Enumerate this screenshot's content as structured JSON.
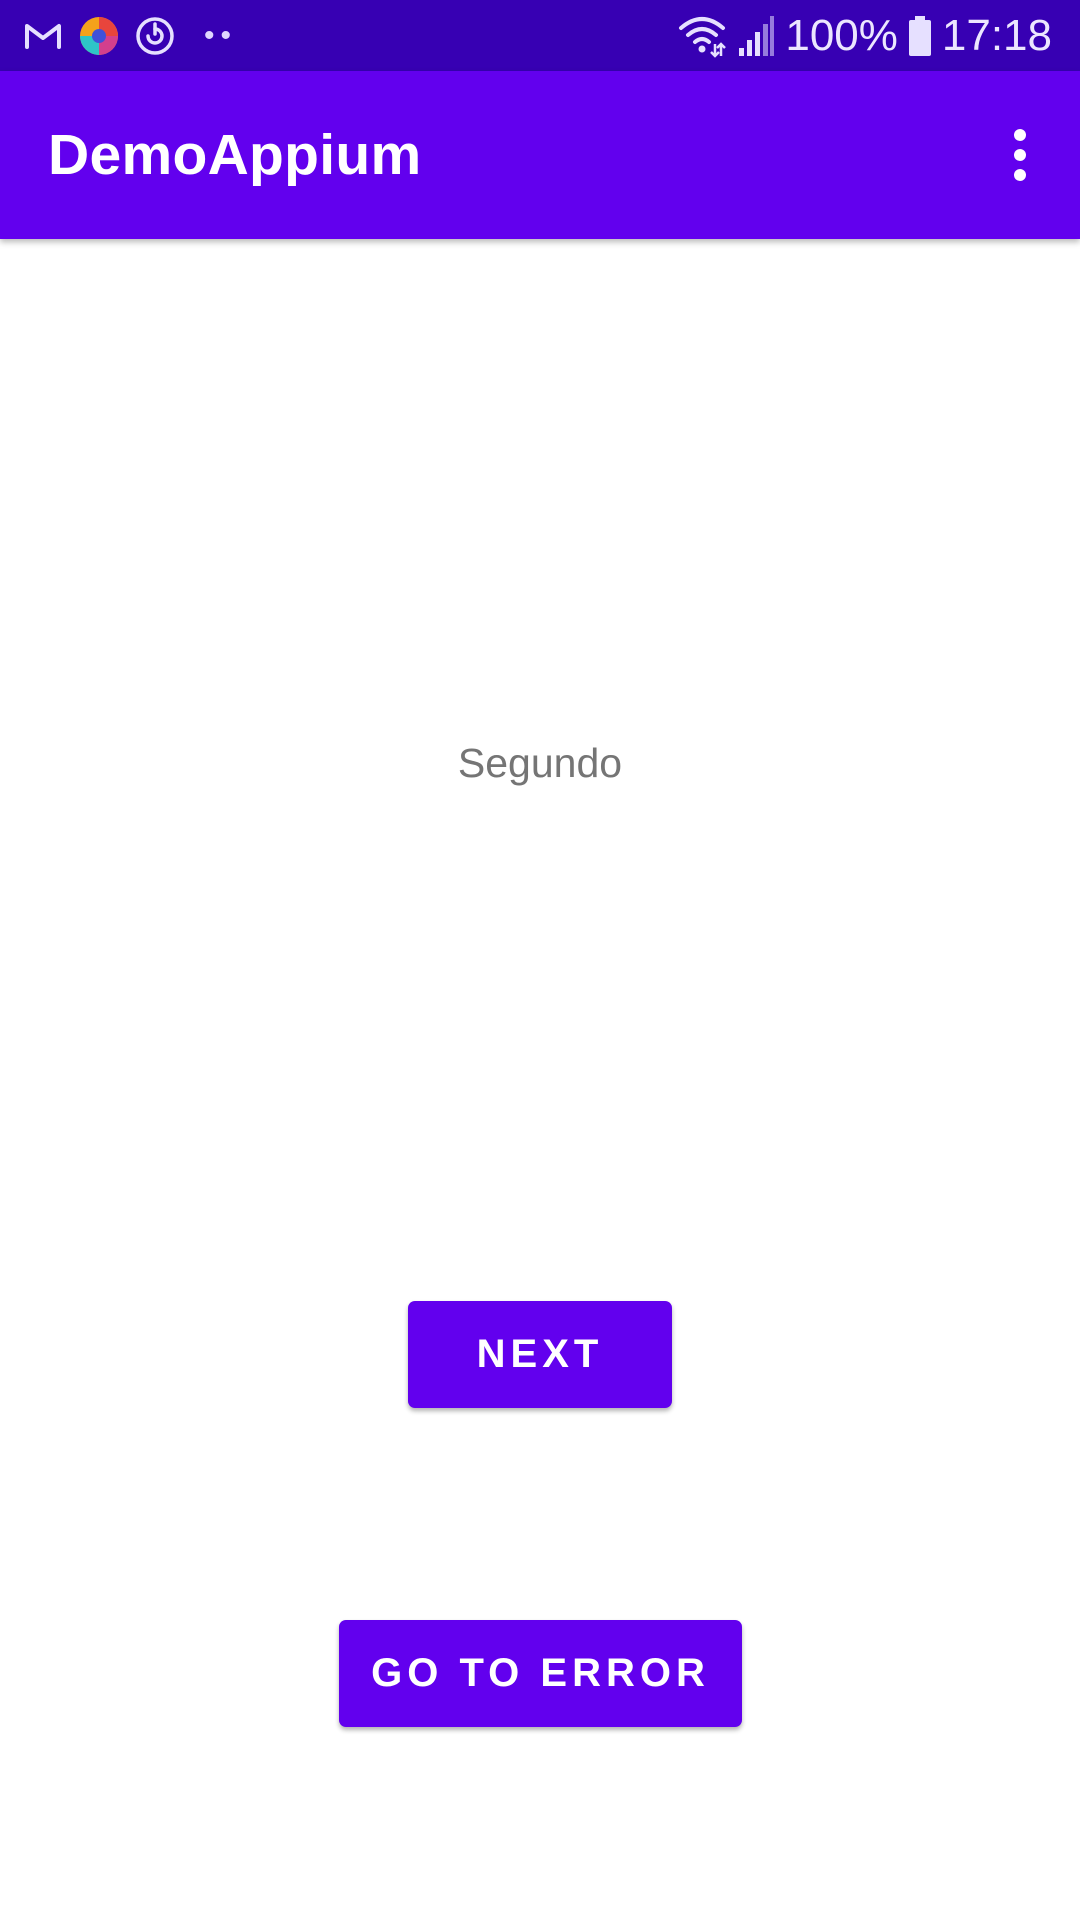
{
  "status_bar": {
    "left_icons": [
      "gmail-icon",
      "browser-icon",
      "sync-icon"
    ],
    "overflow_dots": "••",
    "right_icons": [
      "wifi-icon",
      "signal-icon"
    ],
    "battery_percent": "100%",
    "time": "17:18"
  },
  "app_bar": {
    "title": "DemoAppium",
    "menu_icon": "more-vert-icon"
  },
  "main": {
    "label": "Segundo",
    "next_button": "NEXT",
    "error_button": "GO TO ERROR"
  },
  "colors": {
    "status_bar": "#3700b3",
    "primary": "#6200ee",
    "text_secondary": "#757575",
    "background": "#ffffff"
  }
}
